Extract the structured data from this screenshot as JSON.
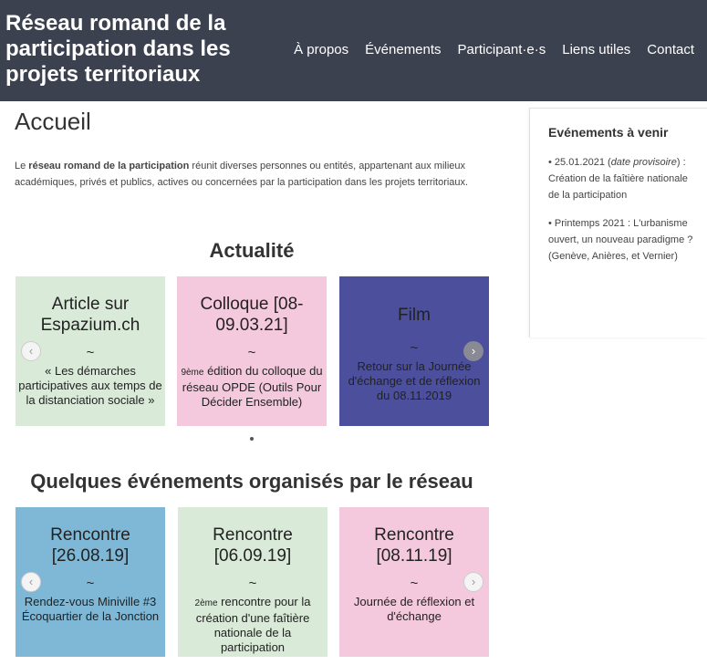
{
  "header": {
    "title": "Réseau romand de la participation dans les projets territoriaux",
    "nav": [
      "À propos",
      "Événements",
      "Participant·e·s",
      "Liens utiles",
      "Contact"
    ]
  },
  "page": {
    "title": "Accueil",
    "intro_prefix": "Le ",
    "intro_bold": "réseau romand de la participation",
    "intro_rest": " réunit diverses personnes ou entités, appartenant aux milieux académiques, privés et publics, actives ou concernées par la participation dans les projets territoriaux."
  },
  "sidebar": {
    "title": "Evénements à venir",
    "item1_date": "• 25.01.2021 (",
    "item1_italic": "date provisoire",
    "item1_rest": ") : Création de la faîtière nationale de la participation",
    "item2": "• Printemps 2021 : L'urbanisme ouvert, un nouveau paradigme ? (Genève, Anières, et Vernier)"
  },
  "actualite": {
    "title": "Actualité",
    "cards": [
      {
        "title": "Article sur Espazium.ch",
        "tilde": "~",
        "desc": "« Les démarches participatives aux temps de la distanciation sociale »",
        "color": "#d9ead8"
      },
      {
        "title": "Colloque [08-09.03.21]",
        "tilde": "~",
        "desc_sup": "9ème",
        "desc": " édition du colloque du réseau OPDE (Outils Pour Décider Ensemble)",
        "color": "#f5c9dd"
      },
      {
        "title": "Film",
        "tilde": "~",
        "desc": "Retour sur la Journée d'échange et de réflexion du 08.11.2019",
        "color": "#4b4f9c"
      }
    ]
  },
  "evenements": {
    "title": "Quelques événements organisés par le réseau",
    "cards": [
      {
        "title": "Rencontre [26.08.19]",
        "tilde": "~",
        "desc": "Rendez-vous Miniville #3 Écoquartier de la Jonction",
        "color": "#7fb8d6"
      },
      {
        "title": "Rencontre [06.09.19]",
        "tilde": "~",
        "desc_sup": "2ème",
        "desc": " rencontre pour la création d'une faîtière nationale de la participation",
        "color": "#d9ead8"
      },
      {
        "title": "Rencontre [08.11.19]",
        "tilde": "~",
        "desc": "Journée de réflexion et d'échange",
        "color": "#f5c9dd"
      }
    ]
  },
  "icons": {
    "prev": "chevron-left-icon",
    "next": "chevron-right-icon"
  }
}
